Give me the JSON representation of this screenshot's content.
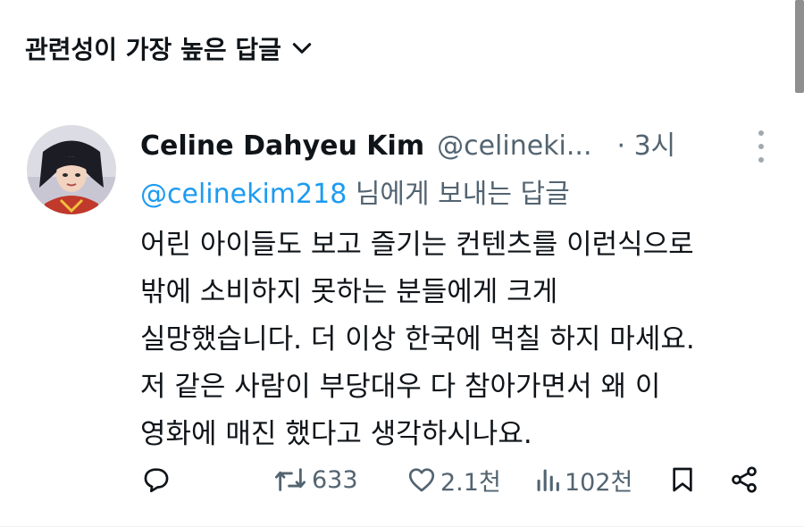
{
  "header": {
    "sort_label": "관련성이 가장 높은 답글"
  },
  "reply": {
    "author_name": "Celine Dahyeu Kim",
    "author_handle": "@celineki...",
    "time": "· 3시",
    "replying_to_handle": "@celinekim218",
    "replying_to_suffix": " 님에게 보내는 답글",
    "body_lines": [
      "어린 아이들도 보고 즐기는 컨텐츠를 이런식으로",
      "밖에 소비하지 못하는 분들에게 크게",
      "실망했습니다. 더 이상 한국에 먹칠 하지 마세요.",
      "저 같은 사람이 부당대우 다 참아가면서 왜 이",
      "영화에 매진 했다고 생각하시나요."
    ]
  },
  "actions": {
    "reply_count": "",
    "retweet_count": "633",
    "like_count": "2.1천",
    "view_count": "102천"
  },
  "icons": {
    "sort": "chevron-down-icon",
    "more": "more-vertical-icon",
    "reply": "reply-icon",
    "retweet": "retweet-icon",
    "like": "heart-icon",
    "views": "bar-chart-icon",
    "bookmark": "bookmark-icon",
    "share": "share-icon"
  },
  "colors": {
    "text": "#0f1419",
    "secondary": "#536471",
    "link": "#1d9bf0"
  }
}
